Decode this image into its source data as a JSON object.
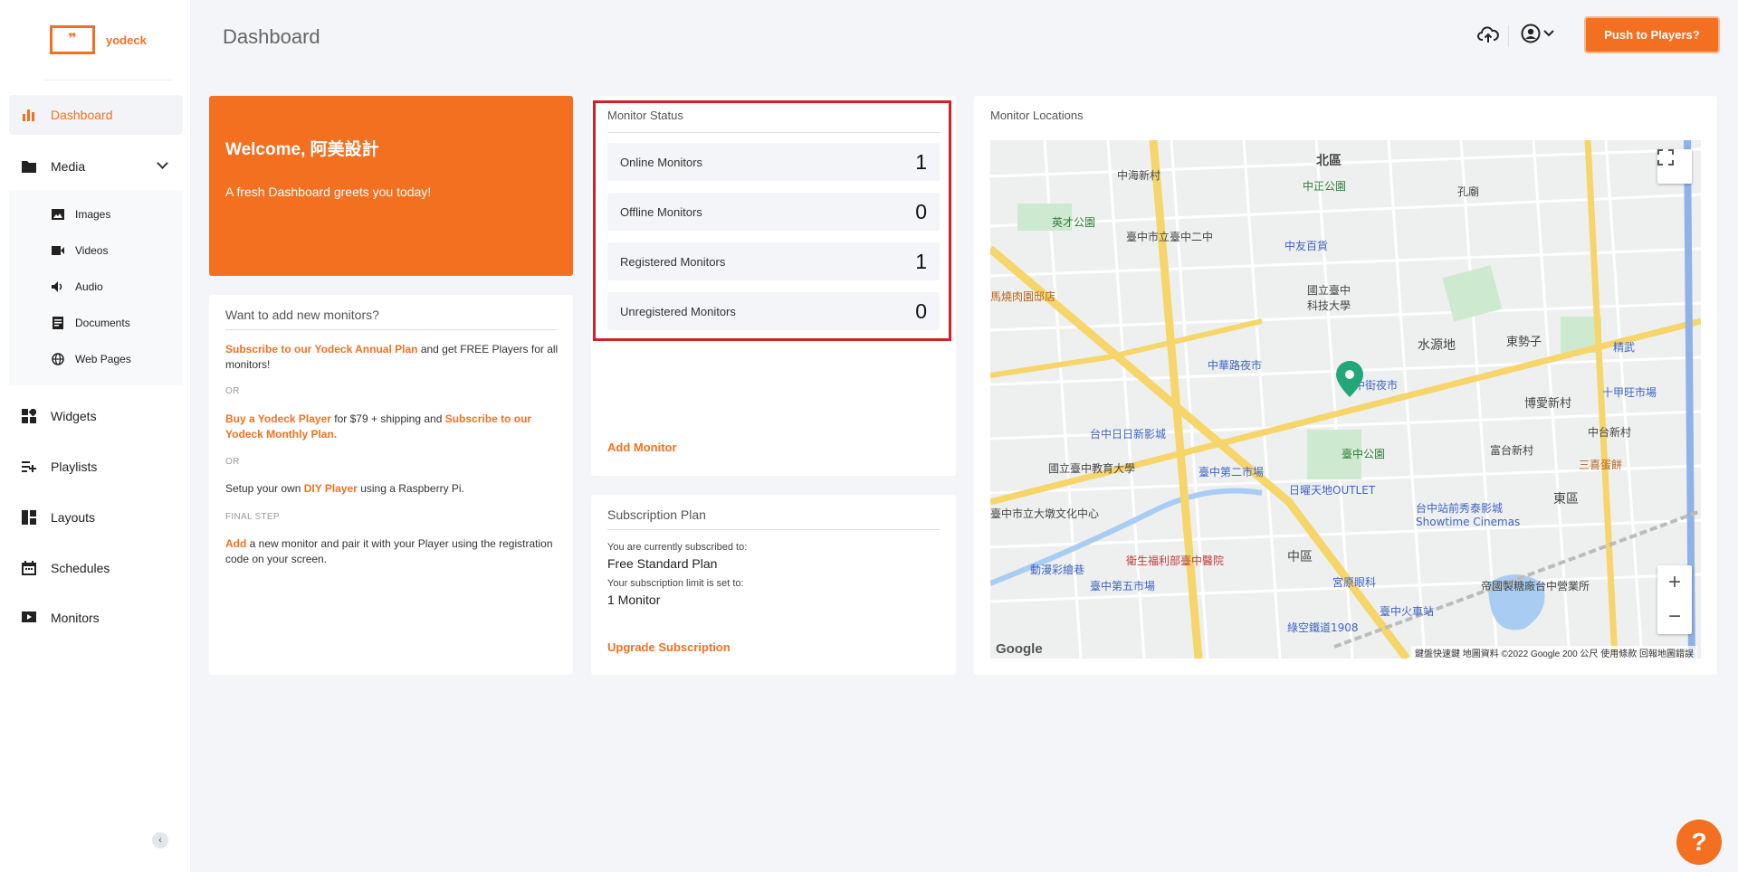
{
  "brand": {
    "logo_mark": "❞",
    "name": "yodeck"
  },
  "header": {
    "title": "Dashboard",
    "push_button": "Push to Players?"
  },
  "sidebar": {
    "items": [
      {
        "label": "Dashboard",
        "icon": "bar-chart-icon",
        "active": true
      },
      {
        "label": "Media",
        "icon": "folder-icon",
        "expanded": true
      },
      {
        "label": "Widgets",
        "icon": "widgets-icon"
      },
      {
        "label": "Playlists",
        "icon": "playlist-icon"
      },
      {
        "label": "Layouts",
        "icon": "layout-icon"
      },
      {
        "label": "Schedules",
        "icon": "calendar-icon"
      },
      {
        "label": "Monitors",
        "icon": "monitor-icon"
      }
    ],
    "media_subitems": [
      {
        "label": "Images",
        "icon": "image-icon"
      },
      {
        "label": "Videos",
        "icon": "video-icon"
      },
      {
        "label": "Audio",
        "icon": "speaker-icon"
      },
      {
        "label": "Documents",
        "icon": "document-icon"
      },
      {
        "label": "Web Pages",
        "icon": "globe-icon"
      }
    ]
  },
  "welcome": {
    "title": "Welcome, 阿美設計",
    "subtitle": "A fresh Dashboard greets you today!"
  },
  "howto": {
    "heading": "Want to add new monitors?",
    "step1_link": "Subscribe to our Yodeck Annual Plan",
    "step1_text": " and get FREE Players for all monitors!",
    "or1": "OR",
    "step2_link1": "Buy a Yodeck Player",
    "step2_text": " for $79 + shipping and ",
    "step2_link2": "Subscribe to our Yodeck Monthly Plan.",
    "or2": "OR",
    "step3_text1": "Setup your own ",
    "step3_link": "DIY Player",
    "step3_text2": " using a Raspberry Pi.",
    "final_label": "FINAL STEP",
    "final_link": "Add",
    "final_text": " a new monitor and pair it with your Player using the registration code on your screen."
  },
  "monitor_status": {
    "heading": "Monitor Status",
    "stats": [
      {
        "label": "Online Monitors",
        "value": "1"
      },
      {
        "label": "Offline Monitors",
        "value": "0"
      },
      {
        "label": "Registered Monitors",
        "value": "1"
      },
      {
        "label": "Unregistered Monitors",
        "value": "0"
      }
    ],
    "add_link": "Add Monitor"
  },
  "subscription": {
    "heading": "Subscription Plan",
    "subscribed_label": "You are currently subscribed to:",
    "plan": "Free Standard Plan",
    "limit_label": "Your subscription limit is set to:",
    "limit": "1 Monitor",
    "upgrade_link": "Upgrade Subscription"
  },
  "locations": {
    "heading": "Monitor Locations",
    "map_labels": {
      "north": "北區",
      "zhongzheng_park": "中正公園",
      "zhonghai": "中海新村",
      "yingcai_park": "英才公園",
      "school": "臺中市立臺中二中",
      "zhongyou": "中友百貨",
      "museum": "國立臺中科技大學",
      "shuiyuan": "水源地",
      "dongshi": "東勢子",
      "bbq": "馬燒肉園邸店",
      "night_market": "中華路夜市",
      "yizhong": "一中街夜市",
      "bo_ai": "博愛新村",
      "zhongtai": "中台新村",
      "fugui": "富台新村",
      "ririxin": "台中日日新影城",
      "teacher_univ": "國立臺中教育大學",
      "market2": "臺中第二市場",
      "taichung_park": "臺中公園",
      "outlet": "日曜天地OUTLET",
      "dadun": "臺中市立大墩文化中心",
      "hospital": "衛生福利部臺中醫院",
      "central": "中區",
      "east": "東區",
      "showtime": "台中站前秀泰影城 Showtime Cinemas",
      "fifth_market": "臺中第五市場",
      "comic": "動漫彩繪巷",
      "gongyuan": "宮原眼科",
      "station": "臺中火車站",
      "green_space": "綠空鐵道1908",
      "sugar": "帝國製糖廠台中營業所",
      "kongmiao": "孔廟",
      "sanxi": "三喜蛋餅",
      "shijiu": "十甲旺市場",
      "jingwu": "精武",
      "google": "Google",
      "attribution": "鍵盤快速鍵   地圖資料 ©2022 Google   200 公尺         使用條款   回報地圖錯誤"
    }
  },
  "help_button": "?",
  "colors": {
    "accent": "#f37021",
    "highlight": "#d11f26"
  }
}
